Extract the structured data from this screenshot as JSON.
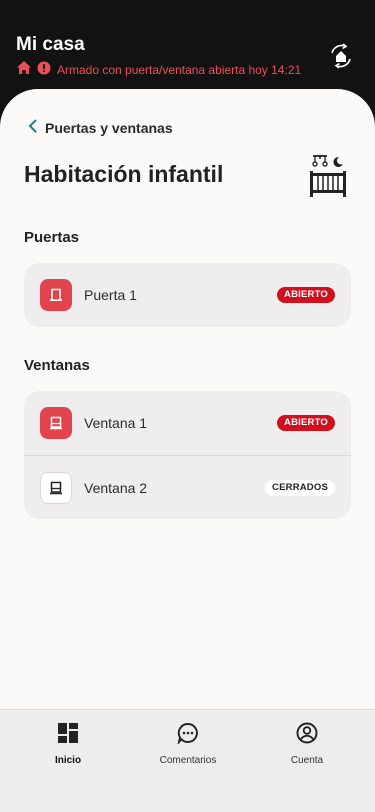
{
  "header": {
    "title": "Mi casa",
    "status": "Armado con puerta/ventana abierta hoy 14:21"
  },
  "colors": {
    "alert": "#ec4f56",
    "open_badge": "#cf1021",
    "open_icon": "#e3434c"
  },
  "icons": {
    "status_home": "home-icon",
    "status_alert": "alert-icon",
    "sync": "home-sync-icon",
    "back": "chevron-left-icon",
    "room": "crib-icon",
    "door": "door-icon",
    "window": "window-icon"
  },
  "main": {
    "back_label": "Puertas y ventanas",
    "room_title": "Habitación infantil",
    "doors": {
      "title": "Puertas",
      "items": [
        {
          "label": "Puerta 1",
          "status": "ABIERTO"
        }
      ]
    },
    "windows": {
      "title": "Ventanas",
      "items": [
        {
          "label": "Ventana 1",
          "status": "ABIERTO"
        },
        {
          "label": "Ventana 2",
          "status": "CERRADOS"
        }
      ]
    }
  },
  "nav": {
    "items": [
      {
        "label": "Inicio",
        "icon": "dashboard-icon",
        "active": true
      },
      {
        "label": "Comentarios",
        "icon": "chat-icon",
        "active": false
      },
      {
        "label": "Cuenta",
        "icon": "account-icon",
        "active": false
      }
    ]
  }
}
